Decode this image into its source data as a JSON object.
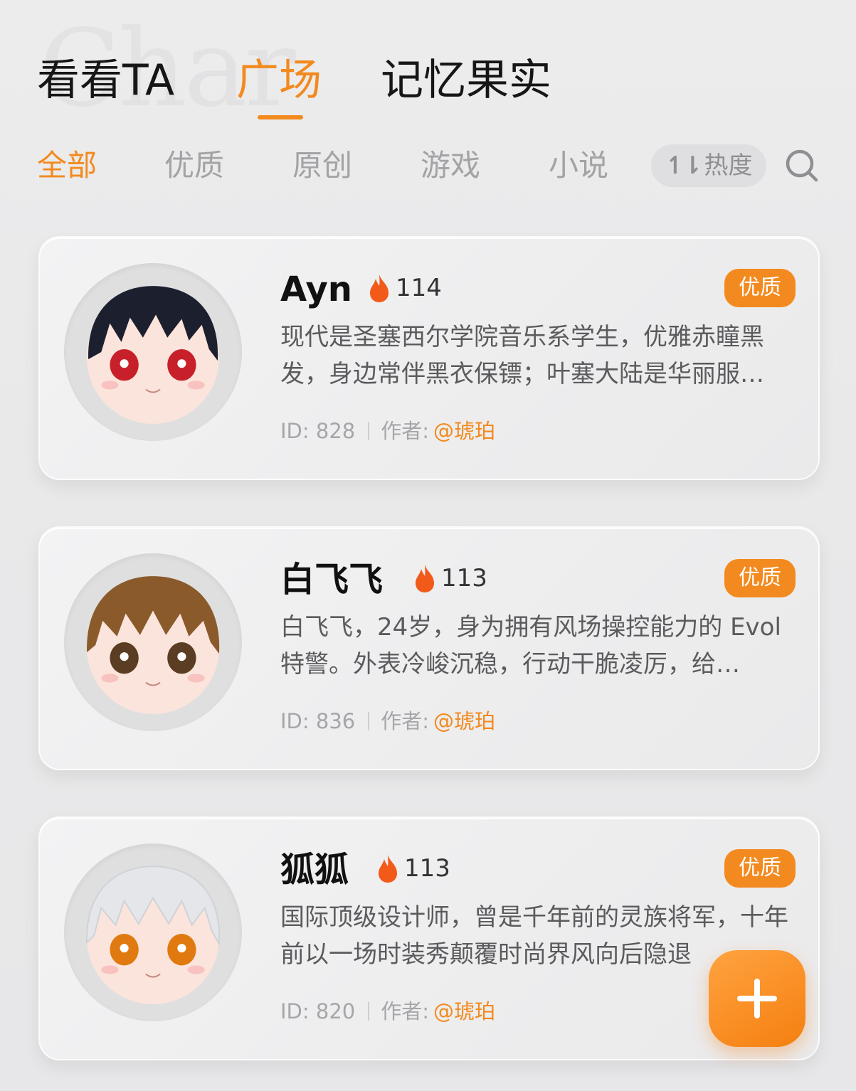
{
  "top_tabs": [
    {
      "label": "看看TA",
      "active": false
    },
    {
      "label": "广场",
      "active": true
    },
    {
      "label": "记忆果实",
      "active": false
    }
  ],
  "filters": [
    {
      "label": "全部",
      "active": true
    },
    {
      "label": "优质",
      "active": false
    },
    {
      "label": "原创",
      "active": false
    },
    {
      "label": "游戏",
      "active": false
    },
    {
      "label": "小说",
      "active": false
    }
  ],
  "sort": {
    "icon": "sort-icon",
    "label": "热度"
  },
  "search": {
    "icon": "search-icon"
  },
  "cards": [
    {
      "name": "Ayn",
      "heat": "114",
      "badge": "优质",
      "description": "现代是圣塞西尔学院音乐系学生，优雅赤瞳黑发，身边常伴黑衣保镖；叶塞大陆是华丽服…",
      "id_text": "ID: 828",
      "author_label": "作者:",
      "author": "@琥珀",
      "hair_color": "#1c1f2e",
      "eye_color": "#c8202a"
    },
    {
      "name": "白飞飞",
      "heat": "113",
      "badge": "优质",
      "description": "白飞飞，24岁，身为拥有风场操控能力的 Evol 特警。外表冷峻沉稳，行动干脆凌厉，给…",
      "id_text": "ID: 836",
      "author_label": "作者:",
      "author": "@琥珀",
      "hair_color": "#8a5a2b",
      "eye_color": "#5a3d22"
    },
    {
      "name": "狐狐",
      "heat": "113",
      "badge": "优质",
      "description": "国际顶级设计师，曾是千年前的灵族将军，十年前以一场时装秀颠覆时尚界风向后隐退",
      "id_text": "ID: 820",
      "author_label": "作者:",
      "author": "@琥珀",
      "hair_color": "#e4e6ea",
      "eye_color": "#e07a10"
    }
  ],
  "fab": {
    "icon": "plus-icon"
  },
  "colors": {
    "accent": "#f28a1e",
    "badge": "#f38a1f"
  }
}
